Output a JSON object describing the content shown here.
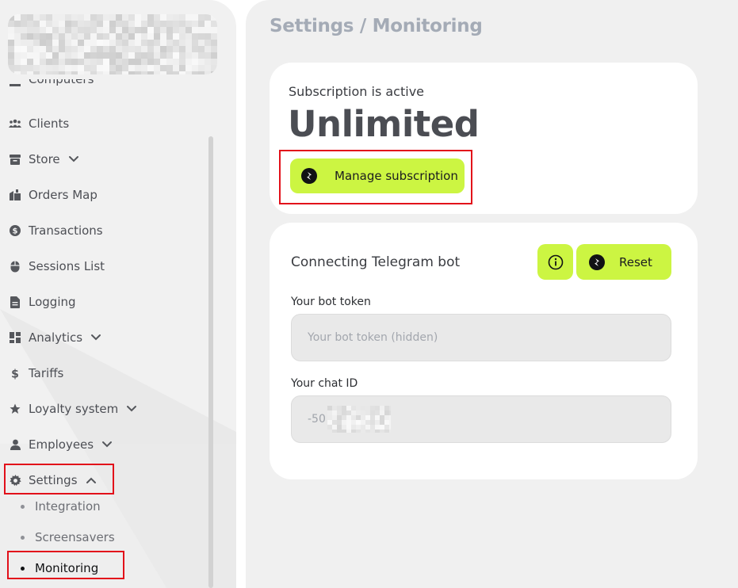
{
  "sidebar": {
    "partial_item": "Computers",
    "items": [
      {
        "label": "Clients",
        "icon": "users-icon"
      },
      {
        "label": "Store",
        "icon": "store-icon",
        "expandable": true
      },
      {
        "label": "Orders Map",
        "icon": "orders-map-icon"
      },
      {
        "label": "Transactions",
        "icon": "dollar-circle-icon"
      },
      {
        "label": "Sessions List",
        "icon": "mouse-icon"
      },
      {
        "label": "Logging",
        "icon": "document-icon"
      },
      {
        "label": "Analytics",
        "icon": "dashboard-icon",
        "expandable": true
      },
      {
        "label": "Tariffs",
        "icon": "dollar-icon"
      },
      {
        "label": "Loyalty system",
        "icon": "star-icon",
        "expandable": true
      },
      {
        "label": "Employees",
        "icon": "user-icon",
        "expandable": true
      },
      {
        "label": "Settings",
        "icon": "gear-icon",
        "expandable": true,
        "expanded": true
      }
    ],
    "settings_subitems": [
      {
        "label": "Integration"
      },
      {
        "label": "Screensavers"
      },
      {
        "label": "Monitoring",
        "active": true
      }
    ]
  },
  "main": {
    "breadcrumb": "Settings / Monitoring",
    "subscription": {
      "status": "Subscription is active",
      "plan": "Unlimited",
      "manage_label": "Manage subscription"
    },
    "telegram": {
      "title": "Connecting Telegram bot",
      "reset_label": "Reset",
      "token_label": "Your bot token",
      "token_placeholder": "Your bot token (hidden)",
      "chat_label": "Your chat ID",
      "chat_value": "-50"
    }
  },
  "colors": {
    "accent": "#ccf542",
    "highlight": "#e2101a",
    "sidebar_bg": "#f1f1f1",
    "main_bg": "#f0f0f0"
  }
}
